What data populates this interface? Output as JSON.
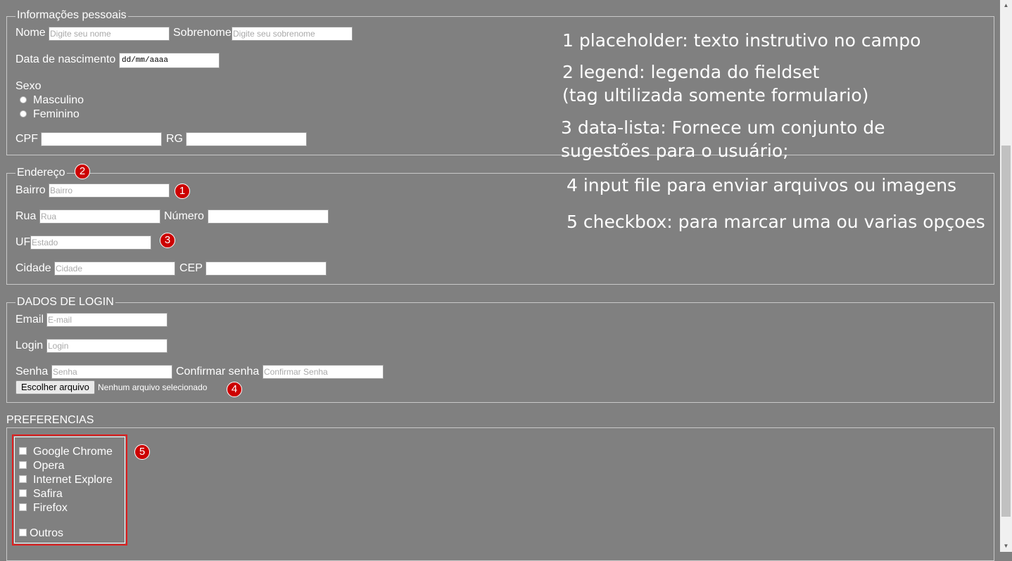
{
  "personal": {
    "legend": "Informações pessoais",
    "nome_label": "Nome",
    "nome_placeholder": "Digite seu nome",
    "sobrenome_label": "Sobrenome",
    "sobrenome_placeholder": "Digite seu sobrenome",
    "nascimento_label": "Data de nascimento",
    "nascimento_value": "dd/mm/aaaa",
    "sexo_label": "Sexo",
    "sexo_options": [
      "Masculino",
      "Feminino"
    ],
    "cpf_label": "CPF",
    "rg_label": "RG"
  },
  "address": {
    "legend": "Endereço",
    "bairro_label": "Bairro",
    "bairro_placeholder": "Bairro",
    "rua_label": "Rua",
    "rua_placeholder": "Rua",
    "numero_label": "Número",
    "uf_label": "UF",
    "uf_placeholder": "Estado",
    "cidade_label": "Cidade",
    "cidade_placeholder": "Cidade",
    "cep_label": "CEP"
  },
  "login": {
    "legend": "DADOS DE LOGIN",
    "email_label": "Email",
    "email_placeholder": "E-mail",
    "login_label": "Login",
    "login_placeholder": "Login",
    "senha_label": "Senha",
    "senha_placeholder": "Senha",
    "confirmar_label": "Confirmar senha",
    "confirmar_placeholder": "Confirmar Senha",
    "file_button": "Escolher arquivo",
    "file_status": "Nenhum arquivo selecionado"
  },
  "preferences": {
    "legend": "PREFERENCIAS",
    "options": [
      "Google Chrome",
      "Opera",
      "Internet Explore",
      "Safira",
      "Firefox"
    ],
    "other": "Outros"
  },
  "badges": [
    "1",
    "2",
    "3",
    "4",
    "5"
  ],
  "notes": [
    "1 placeholder: texto instrutivo no campo",
    "2 legend: legenda do fieldset",
    "(tag ultilizada somente formulario)",
    "3 data-lista: Fornece um conjunto de",
    " sugestões para o usuário;",
    "4 input file para enviar arquivos ou imagens",
    "5 checkbox: para marcar uma ou varias opçoes"
  ],
  "colors": {
    "background": "#808080",
    "badge": "#cc0000",
    "highlight_box": "#e02020"
  }
}
